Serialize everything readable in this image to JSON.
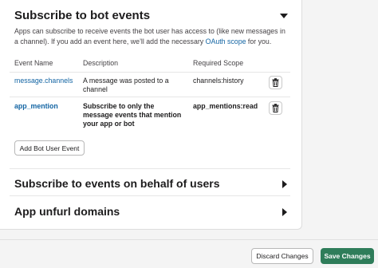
{
  "bot_events": {
    "title": "Subscribe to bot events",
    "description_pre": "Apps can subscribe to receive events the bot user has access to (like new messages in a channel). If you add an event here, we’ll add the necessary ",
    "description_link": "OAuth scope",
    "description_post": " for you.",
    "columns": [
      "Event Name",
      "Description",
      "Required Scope"
    ],
    "rows": [
      {
        "event": "message.channels",
        "description": "A message was posted to a channel",
        "scope": "channels:history"
      },
      {
        "event": "app_mention",
        "description": "Subscribe to only the message events that mention your app or bot",
        "scope": "app_mentions:read"
      }
    ],
    "add_button": "Add Bot User Event"
  },
  "user_events": {
    "title": "Subscribe to events on behalf of users"
  },
  "unfurl": {
    "title": "App unfurl domains"
  },
  "footer": {
    "discard": "Discard Changes",
    "save": "Save Changes"
  },
  "colors": {
    "link": "#1264a3",
    "save_button": "#2f7d5a"
  }
}
